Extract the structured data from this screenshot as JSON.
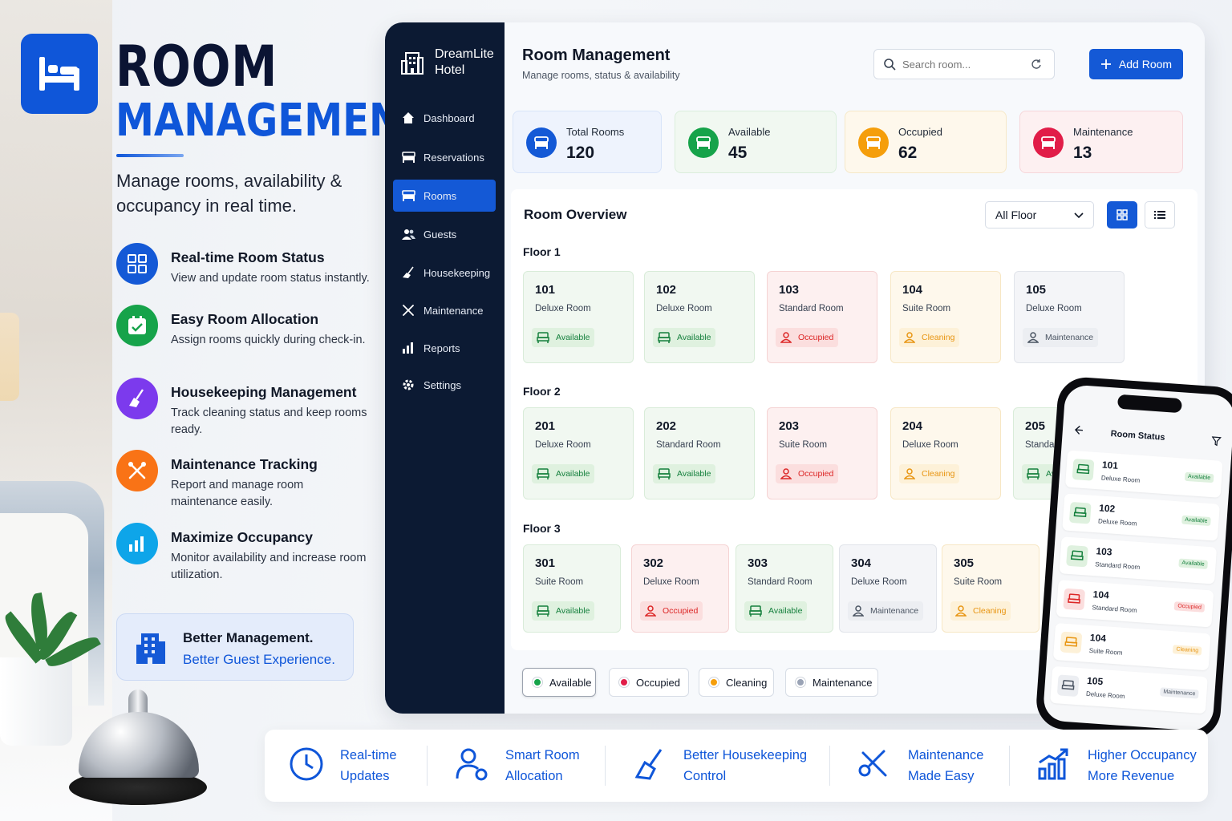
{
  "hero": {
    "title_line1": "ROOM",
    "title_line2": "MANAGEMENT",
    "tagline": "Manage rooms, availability & occupancy in real time.",
    "logo_icon": "bed-icon",
    "brand_color": "#0f56d9"
  },
  "features": [
    {
      "title": "Real-time Room Status",
      "desc": "View and update room status instantly.",
      "icon": "room-grid-icon",
      "color": "#1459d6"
    },
    {
      "title": "Easy Room Allocation",
      "desc": "Assign rooms quickly during check-in.",
      "icon": "calendar-check-icon",
      "color": "#16a34a"
    },
    {
      "title": "Housekeeping Management",
      "desc": "Track cleaning status and keep rooms ready.",
      "icon": "broom-icon",
      "color": "#7c3aed"
    },
    {
      "title": "Maintenance Tracking",
      "desc": "Report and manage room maintenance easily.",
      "icon": "tools-icon",
      "color": "#f97316"
    },
    {
      "title": "Maximize Occupancy",
      "desc": "Monitor availability and increase room utilization.",
      "icon": "bar-chart-icon",
      "color": "#0ea5e9"
    }
  ],
  "better": {
    "line1": "Better Management.",
    "line2": "Better Guest Experience.",
    "icon": "hotel-building-icon"
  },
  "app": {
    "brand": "DreamLite Hotel",
    "nav": [
      {
        "label": "Dashboard",
        "icon": "home-icon",
        "active": false
      },
      {
        "label": "Reservations",
        "icon": "bed-icon",
        "active": false
      },
      {
        "label": "Rooms",
        "icon": "bed-icon",
        "active": true
      },
      {
        "label": "Guests",
        "icon": "users-icon",
        "active": false
      },
      {
        "label": "Housekeeping",
        "icon": "broom-icon",
        "active": false
      },
      {
        "label": "Maintenance",
        "icon": "tools-icon",
        "active": false
      },
      {
        "label": "Reports",
        "icon": "bar-chart-icon",
        "active": false
      },
      {
        "label": "Settings",
        "icon": "gear-icon",
        "active": false
      }
    ],
    "page_title": "Room Management",
    "page_subtitle": "Manage rooms, status & availability",
    "search_placeholder": "Search room...",
    "add_button": "Add Room",
    "stats": [
      {
        "label": "Total Rooms",
        "value": "120",
        "color": "#1459d6",
        "bg": "#eef3fd",
        "border": "#d8e4f9",
        "icon": "bed-icon"
      },
      {
        "label": "Available",
        "value": "45",
        "color": "#16a34a",
        "bg": "#f1f8f1",
        "border": "#dbeedc",
        "icon": "bed-check-icon"
      },
      {
        "label": "Occupied",
        "value": "62",
        "color": "#f59e0b",
        "bg": "#fef8ec",
        "border": "#f6e8c8",
        "icon": "bed-occupied-icon"
      },
      {
        "label": "Maintenance",
        "value": "13",
        "color": "#e11d48",
        "bg": "#fdf0f1",
        "border": "#f6d6da",
        "icon": "tools-icon"
      }
    ],
    "overview_title": "Room Overview",
    "floor_filter": "All Floor",
    "floors": [
      {
        "label": "Floor 1",
        "rooms": [
          {
            "number": "101",
            "type": "Deluxe Room",
            "status": "Available"
          },
          {
            "number": "102",
            "type": "Deluxe Room",
            "status": "Available"
          },
          {
            "number": "103",
            "type": "Standard Room",
            "status": "Occupied"
          },
          {
            "number": "104",
            "type": "Suite Room",
            "status": "Cleaning"
          },
          {
            "number": "105",
            "type": "Deluxe Room",
            "status": "Maintenance"
          }
        ]
      },
      {
        "label": "Floor 2",
        "rooms": [
          {
            "number": "201",
            "type": "Deluxe Room",
            "status": "Available"
          },
          {
            "number": "202",
            "type": "Standard Room",
            "status": "Available"
          },
          {
            "number": "203",
            "type": "Suite Room",
            "status": "Occupied"
          },
          {
            "number": "204",
            "type": "Deluxe Room",
            "status": "Cleaning"
          },
          {
            "number": "205",
            "type": "Standard Room",
            "status": "Available"
          }
        ]
      },
      {
        "label": "Floor 3",
        "rooms": [
          {
            "number": "301",
            "type": "Suite Room",
            "status": "Available"
          },
          {
            "number": "302",
            "type": "Deluxe Room",
            "status": "Occupied"
          },
          {
            "number": "303",
            "type": "Standard Room",
            "status": "Available"
          },
          {
            "number": "304",
            "type": "Deluxe Room",
            "status": "Maintenance"
          },
          {
            "number": "305",
            "type": "Suite Room",
            "status": "Cleaning"
          }
        ]
      }
    ],
    "legend": [
      {
        "label": "Available",
        "color": "#16a34a",
        "selected": true
      },
      {
        "label": "Occupied",
        "color": "#e11d48",
        "selected": false
      },
      {
        "label": "Cleaning",
        "color": "#f59e0b",
        "selected": false
      },
      {
        "label": "Maintenance",
        "color": "#9aa3b5",
        "selected": false
      }
    ]
  },
  "phone": {
    "title": "Room Status",
    "rows": [
      {
        "number": "101",
        "type": "Deluxe Room",
        "status": "Available"
      },
      {
        "number": "102",
        "type": "Deluxe Room",
        "status": "Available"
      },
      {
        "number": "103",
        "type": "Standard Room",
        "status": "Available"
      },
      {
        "number": "104",
        "type": "Standard Room",
        "status": "Occupied"
      },
      {
        "number": "104",
        "type": "Suite Room",
        "status": "Cleaning"
      },
      {
        "number": "105",
        "type": "Deluxe Room",
        "status": "Maintenance"
      }
    ]
  },
  "bottom": [
    {
      "line1": "Real-time",
      "line2": "Updates",
      "icon": "clock-icon"
    },
    {
      "line1": "Smart Room",
      "line2": "Allocation",
      "icon": "user-settings-icon"
    },
    {
      "line1": "Better Housekeeping",
      "line2": "Control",
      "icon": "broom-icon"
    },
    {
      "line1": "Maintenance",
      "line2": "Made Easy",
      "icon": "tools-icon"
    },
    {
      "line1": "Higher Occupancy",
      "line2": "More Revenue",
      "icon": "growth-chart-icon"
    }
  ]
}
